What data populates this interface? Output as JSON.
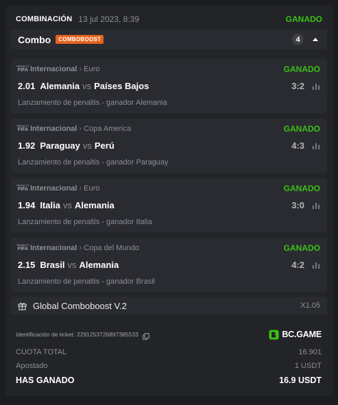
{
  "header": {
    "title": "COMBINACIÓN",
    "date": "13 jul 2023, 8:39",
    "status": "GANADO"
  },
  "combo": {
    "label": "Combo",
    "badge": "COMBOBOOST",
    "count": "4",
    "toggle_icon": "chevron-up-icon"
  },
  "matches": [
    {
      "icon_top": "PENALTY",
      "icon_main": "FIFA",
      "category": "Internacional",
      "separator": "›",
      "league": "Euro",
      "status": "GANADO",
      "odds": "2.01",
      "home": "Alemania",
      "vs": "vs",
      "away": "Países Bajos",
      "score": "3:2",
      "market": "Lanzamiento de penaltis - ganador Alemania"
    },
    {
      "icon_top": "PENALTY",
      "icon_main": "FIFA",
      "category": "Internacional",
      "separator": "›",
      "league": "Copa America",
      "status": "GANADO",
      "odds": "1.92",
      "home": "Paraguay",
      "vs": "vs",
      "away": "Perú",
      "score": "4:3",
      "market": "Lanzamiento de penaltis - ganador Paraguay"
    },
    {
      "icon_top": "PENALTY",
      "icon_main": "FIFA",
      "category": "Internacional",
      "separator": "›",
      "league": "Euro",
      "status": "GANADO",
      "odds": "1.94",
      "home": "Italia",
      "vs": "vs",
      "away": "Alemania",
      "score": "3:0",
      "market": "Lanzamiento de penaltis - ganador Italia"
    },
    {
      "icon_top": "PENALTY",
      "icon_main": "FIFA",
      "category": "Internacional",
      "separator": "›",
      "league": "Copa del Mundo",
      "status": "GANADO",
      "odds": "2.15",
      "home": "Brasil",
      "vs": "vs",
      "away": "Alemania",
      "score": "4:2",
      "market": "Lanzamiento de penaltis - ganador Brasil"
    }
  ],
  "boost": {
    "label": "Global Comboboost V.2",
    "value": "X1.05",
    "icon": "gift-icon"
  },
  "ticket": {
    "label": "Identificación de ticket:",
    "id": "2291253726897385533"
  },
  "brand": {
    "name": "BC.GAME"
  },
  "summary": {
    "total_odds_label": "CUOTA TOTAL",
    "total_odds_value": "16.901",
    "staked_label": "Apostado",
    "staked_value": "1 USDT",
    "won_label": "HAS GANADO",
    "won_value": "16.9 USDT"
  },
  "colors": {
    "win_green": "#3bc117",
    "badge_orange": "#e5641f",
    "brand_green": "#3bc117"
  }
}
